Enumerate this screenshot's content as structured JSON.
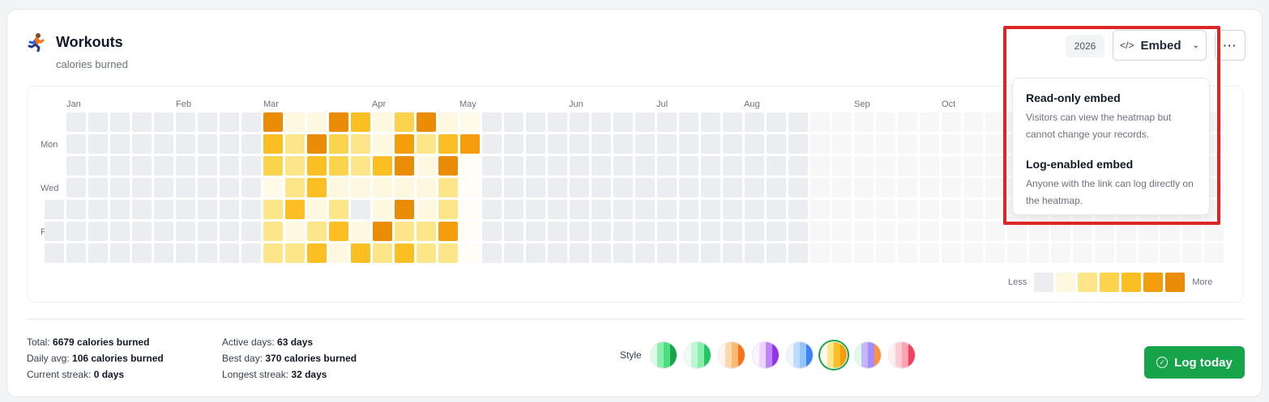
{
  "header": {
    "title": "Workouts",
    "subtitle": "calories burned"
  },
  "toolbar": {
    "year": "2026",
    "embed_label": "Embed",
    "embed_icon": "</>"
  },
  "heatmap": {
    "months": [
      "Jan",
      "Feb",
      "Mar",
      "Apr",
      "May",
      "Jun",
      "Jul",
      "Aug",
      "Sep",
      "Oct"
    ],
    "day_labels": [
      "Mon",
      "Wed",
      "Fri"
    ],
    "palette": [
      "#ebedf0",
      "#fff8e1",
      "#fde68a",
      "#fcd34d",
      "#fbbf24",
      "#f59e0b",
      "#ea8c06"
    ],
    "future_color": "#f7f7f8",
    "level_rows": [
      "...000000000056023120600...........................",
      "...00000000006053031465..........................",
      "...00000000004045134152..........................",
      "...0000000000004112001...........................",
      "...000000000040102161010..........................",
      "...00000000000002050515..........................",
      "..00000000000002004403............................"
    ],
    "legend": {
      "less": "Less",
      "more": "More",
      "levels": [
        0,
        1,
        2,
        3,
        4,
        5,
        6
      ]
    }
  },
  "stats": {
    "col1": [
      {
        "label": "Total:",
        "value": "6679 calories burned"
      },
      {
        "label": "Daily avg:",
        "value": "106 calories burned"
      },
      {
        "label": "Current streak:",
        "value": "0 days"
      }
    ],
    "col2": [
      {
        "label": "Active days:",
        "value": "63 days"
      },
      {
        "label": "Best day:",
        "value": "370 calories burned"
      },
      {
        "label": "Longest streak:",
        "value": "32 days"
      }
    ]
  },
  "style_picker": {
    "label": "Style",
    "selected_index": 5,
    "swatches": [
      [
        "#dcfce7",
        "#86efac",
        "#4ade80",
        "#16a34a"
      ],
      [
        "#f0fdf4",
        "#bbf7d0",
        "#86efac",
        "#22c55e"
      ],
      [
        "#fff7ed",
        "#fed7aa",
        "#fdba74",
        "#f97316"
      ],
      [
        "#faf5ff",
        "#e9d5ff",
        "#c084fc",
        "#9333ea"
      ],
      [
        "#eff6ff",
        "#bfdbfe",
        "#93c5fd",
        "#3b82f6"
      ],
      [
        "#fffbeb",
        "#fde68a",
        "#fbbf24",
        "#f59e0b"
      ],
      [
        "#dcfce7",
        "#c4b5fd",
        "#a78bfa",
        "#fb923c"
      ],
      [
        "#fff1f2",
        "#fecdd3",
        "#fda4af",
        "#f43f5e"
      ]
    ]
  },
  "log_button": {
    "label": "Log today"
  },
  "embed_menu": {
    "items": [
      {
        "title": "Read-only embed",
        "description": "Visitors can view the heatmap but cannot change your records."
      },
      {
        "title": "Log-enabled embed",
        "description": "Anyone with the link can log directly on the heatmap."
      }
    ]
  },
  "highlight_color": "#dc2626"
}
